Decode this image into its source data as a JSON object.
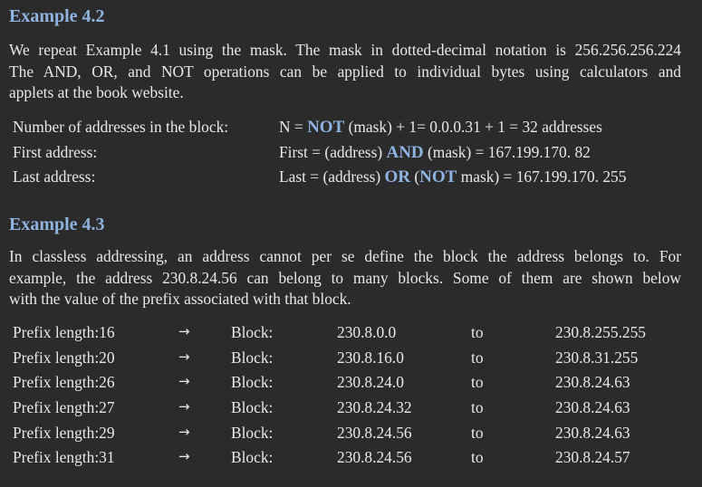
{
  "example42": {
    "title": "Example 4.2",
    "para_lines": [
      "We repeat Example 4.1 using the mask. The mask in dotted-decimal notation is 256.256.256.224",
      "The AND, OR, and NOT operations can be applied to individual bytes using calculators and",
      "applets at the book website."
    ],
    "rows": [
      {
        "label": "Number of addresses in the block:",
        "parts": [
          {
            "t": "N = ",
            "kw": false
          },
          {
            "t": "NOT",
            "kw": true
          },
          {
            "t": " (mask) + 1= 0.0.0.31 + 1 = 32 addresses",
            "kw": false
          }
        ]
      },
      {
        "label": "First address:",
        "parts": [
          {
            "t": "First = (address) ",
            "kw": false
          },
          {
            "t": "AND",
            "kw": true
          },
          {
            "t": " (mask) = 167.199.170. 82",
            "kw": false
          }
        ]
      },
      {
        "label": "Last address:",
        "parts": [
          {
            "t": "Last = (address) ",
            "kw": false
          },
          {
            "t": "OR",
            "kw": true
          },
          {
            "t": " (",
            "kw": false
          },
          {
            "t": "NOT",
            "kw": true
          },
          {
            "t": " mask) = 167.199.170. 255",
            "kw": false
          }
        ]
      }
    ]
  },
  "example43": {
    "title": "Example 4.3",
    "para_lines": [
      "In classless addressing, an address cannot per se define the block the address belongs to. For",
      "example, the address 230.8.24.56 can belong to many blocks. Some of them are shown below",
      "with the value of the prefix associated with that block."
    ],
    "arrow": "→",
    "block_label": "Block:",
    "to_label": "to",
    "rows": [
      {
        "prefix": "Prefix length:16",
        "start": "230.8.0.0",
        "end": "230.8.255.255"
      },
      {
        "prefix": "Prefix length:20",
        "start": "230.8.16.0",
        "end": "230.8.31.255"
      },
      {
        "prefix": "Prefix length:26",
        "start": "230.8.24.0",
        "end": "230.8.24.63"
      },
      {
        "prefix": "Prefix length:27",
        "start": "230.8.24.32",
        "end": "230.8.24.63"
      },
      {
        "prefix": "Prefix length:29",
        "start": "230.8.24.56",
        "end": "230.8.24.63"
      },
      {
        "prefix": "Prefix length:31",
        "start": "230.8.24.56",
        "end": "230.8.24.57"
      }
    ]
  }
}
